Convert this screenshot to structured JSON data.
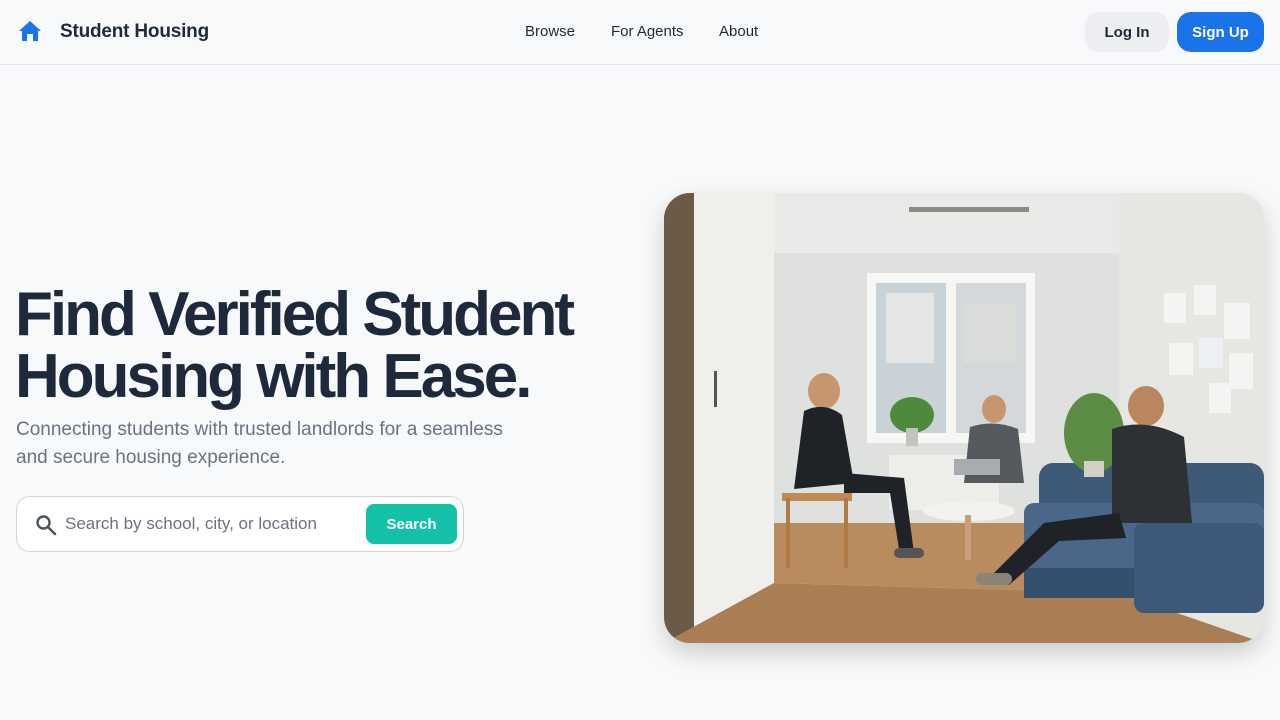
{
  "header": {
    "brand": "Student Housing",
    "brand_icon": "home-icon",
    "nav": [
      "Browse",
      "For Agents",
      "About"
    ],
    "login_label": "Log In",
    "signup_label": "Sign Up"
  },
  "hero": {
    "title_line1": "Find Verified Student",
    "title_line2": "Housing with Ease.",
    "subtitle_line1": "Connecting students with trusted landlords for a seamless",
    "subtitle_line2": "and secure housing experience.",
    "search": {
      "icon": "search-icon",
      "placeholder": "Search by school, city, or location",
      "value": "",
      "button_label": "Search"
    }
  },
  "colors": {
    "primary": "#1a73e8",
    "accent": "#14c0a8",
    "heading": "#1e293b",
    "muted": "#6b7280",
    "background": "#f7f9fb"
  }
}
